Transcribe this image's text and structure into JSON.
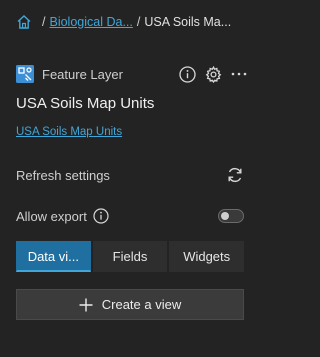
{
  "breadcrumb": {
    "parent_label": "Biological Da...",
    "separator": "/",
    "current_label": "USA Soils Ma..."
  },
  "header": {
    "item_type": "Feature Layer",
    "title": "USA Soils Map Units",
    "link_text": "USA Soils Map Units"
  },
  "settings": {
    "refresh_label": "Refresh settings",
    "export_label": "Allow export",
    "export_enabled": false
  },
  "tabs": [
    {
      "label": "Data vi...",
      "active": true
    },
    {
      "label": "Fields",
      "active": false
    },
    {
      "label": "Widgets",
      "active": false
    }
  ],
  "actions": {
    "create_view_label": "Create a view"
  },
  "colors": {
    "background": "#232323",
    "link": "#41a6d8",
    "accent": "#1f6fa0",
    "layer_icon": "#3b8fd6"
  }
}
